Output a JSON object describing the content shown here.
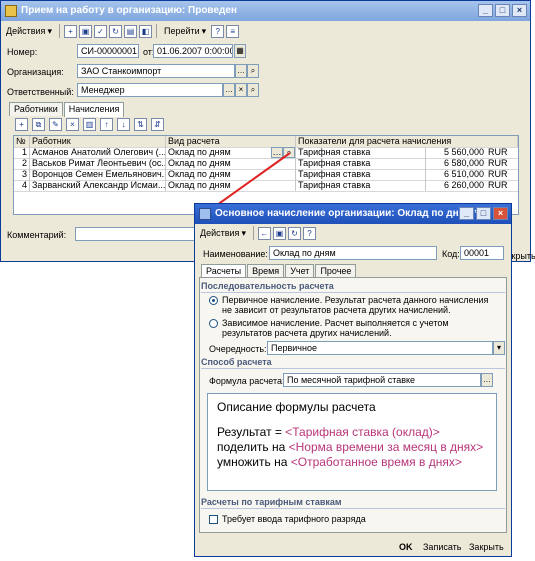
{
  "main_window": {
    "title": "Прием на работу в организацию: Проведен",
    "toolbar": {
      "actions": "Действия",
      "goto": "Перейти"
    },
    "number_label": "Номер:",
    "number_value": "СИ-00000001",
    "from_label": "от:",
    "date_value": "01.06.2007 0:00:00",
    "org_label": "Организация:",
    "org_value": "ЗАО Станкоимпорт",
    "resp_label": "Ответственный:",
    "resp_value": "Менеджер",
    "tabs": [
      "Работники",
      "Начисления"
    ],
    "grid": {
      "headers": [
        "№",
        "Работник",
        "Вид расчета",
        "Показатели для расчета начисления"
      ],
      "rows": [
        {
          "n": "1",
          "worker": "Асманов Анатолий Олегович (...",
          "calc": "Оклад по дням",
          "ind": "Тарифная ставка",
          "amount": "5 560,000",
          "cur": "RUR"
        },
        {
          "n": "2",
          "worker": "Васьков Римат Леонтьевич (ос...",
          "calc": "Оклад по дням",
          "ind": "Тарифная ставка",
          "amount": "6 580,000",
          "cur": "RUR"
        },
        {
          "n": "3",
          "worker": "Воронцов Семен Емельянович...",
          "calc": "Оклад по дням",
          "ind": "Тарифная ставка",
          "amount": "6 510,000",
          "cur": "RUR"
        },
        {
          "n": "4",
          "worker": "Зарванский Александр Исмаи...",
          "calc": "Оклад по дням",
          "ind": "Тарифная ставка",
          "amount": "6 260,000",
          "cur": "RUR"
        }
      ]
    },
    "comment_label": "Комментарий:",
    "close_label": "Закрыть"
  },
  "dialog": {
    "title": "Основное начисление организации: Оклад по дням *",
    "toolbar": {
      "actions": "Действия"
    },
    "name_label": "Наименование:",
    "name_value": "Оклад по дням",
    "code_label": "Код:",
    "code_value": "00001",
    "tabs": [
      "Расчеты",
      "Время",
      "Учет",
      "Прочее"
    ],
    "section_order": "Последовательность расчета",
    "radio1": "Первичное начисление. Результат расчета данного начисления не зависит от результатов расчета других начислений.",
    "radio2": "Зависимое начисление. Расчет выполняется с учетом результатов расчета других начислений.",
    "priority_label": "Очередность:",
    "priority_value": "Первичное",
    "section_method": "Способ расчета",
    "formula_label": "Формула расчета:",
    "formula_value": "По месячной тарифной ставке",
    "formula_desc_title": "Описание формулы расчета",
    "formula_text": {
      "p1": "Результат = ",
      "p2": "<Тарифная ставка (оклад)>",
      "p3": " поделить на ",
      "p4": "<Норма времени за месяц в днях>",
      "p5": " умножить на ",
      "p6": "<Отработанное время в днях>"
    },
    "section_tariff": "Расчеты по тарифным ставкам",
    "tariff_check": "Требует ввода тарифного разряда",
    "buttons": {
      "ok": "OK",
      "save": "Записать",
      "close": "Закрыть"
    }
  }
}
